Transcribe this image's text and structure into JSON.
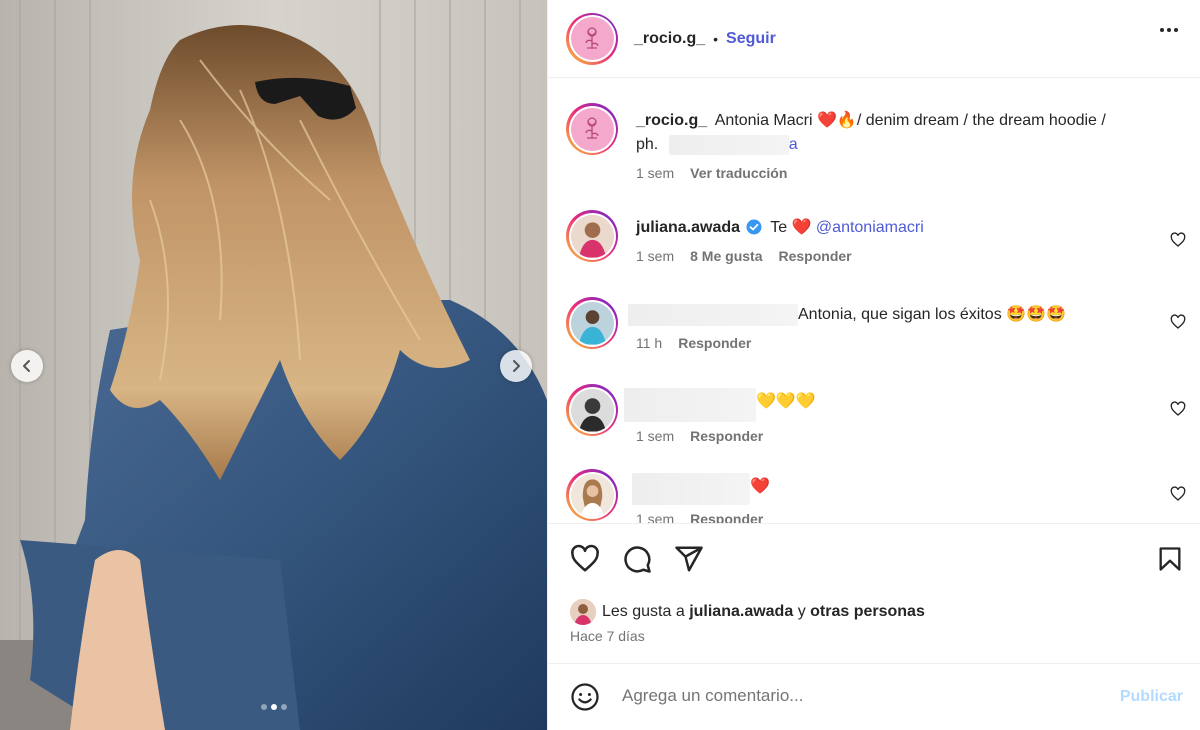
{
  "post": {
    "image_alt": "photo",
    "carousel": {
      "dots": 3,
      "active_index": 1
    }
  },
  "header": {
    "username": "_rocio.g_",
    "separator": "•",
    "follow_label": "Seguir"
  },
  "caption": {
    "username": "_rocio.g_",
    "text": "Antonia Macri ❤️🔥/ denim dream / the dream hoodie /",
    "text_line2": "ph.",
    "mention_visible": "a",
    "time": "1 sem",
    "translate_label": "Ver traducción"
  },
  "comments": [
    {
      "username": "juliana.awada",
      "verified": true,
      "text_before": "Te ❤️",
      "mention": "@antoniamacri",
      "time": "1 sem",
      "likes": "8 Me gusta",
      "reply_label": "Responder"
    },
    {
      "username": "",
      "text": "Antonia, que sigan los éxitos 🤩🤩🤩",
      "time": "11 h",
      "reply_label": "Responder"
    },
    {
      "username": "",
      "text": "💛💛💛",
      "time": "1 sem",
      "reply_label": "Responder"
    },
    {
      "username": "",
      "text": "❤️",
      "time": "1 sem",
      "reply_label": "Responder"
    }
  ],
  "likes": {
    "prefix": "Les gusta a",
    "user": "juliana.awada",
    "connector": "y",
    "others": "otras personas"
  },
  "date": "Hace 7 días",
  "add_comment": {
    "placeholder": "Agrega un comentario...",
    "publish_label": "Publicar"
  },
  "colors": {
    "link_blue": "#4f5bd5",
    "publish_disabled": "#b3dbff",
    "muted": "#737373",
    "ring_gradient": [
      "#f9ce34",
      "#ee2a7b",
      "#6228d7"
    ]
  }
}
